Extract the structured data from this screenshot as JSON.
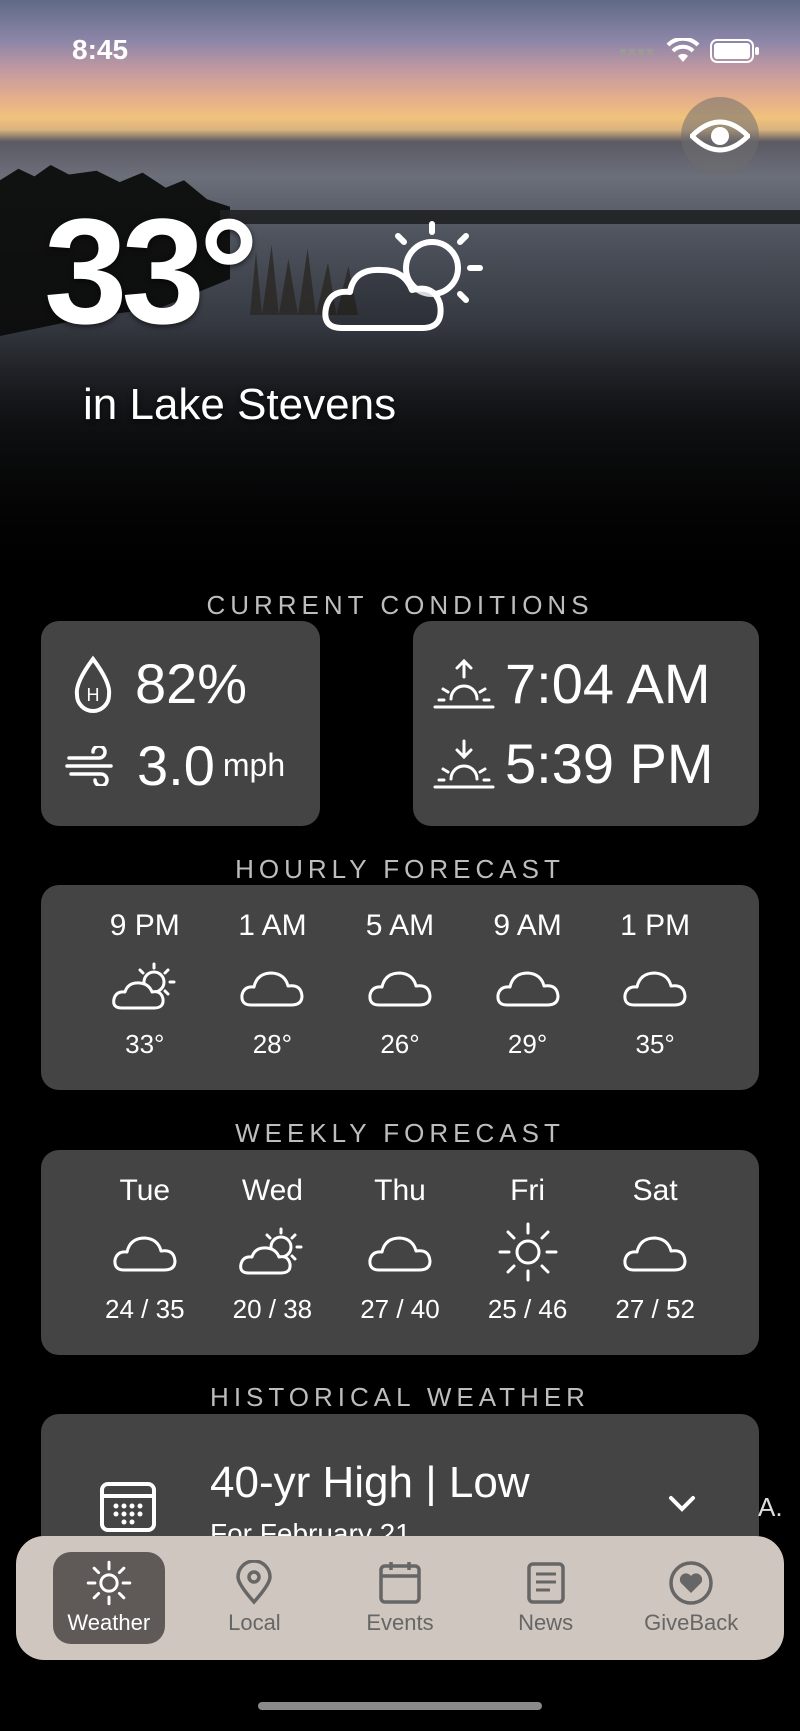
{
  "status_bar": {
    "time": "8:45"
  },
  "hero": {
    "temperature": "33°",
    "location": "in Lake Stevens"
  },
  "sections": {
    "current": "CURRENT CONDITIONS",
    "hourly": "HOURLY FORECAST",
    "weekly": "WEEKLY FORECAST",
    "historical": "HISTORICAL WEATHER"
  },
  "current_conditions": {
    "humidity": "82%",
    "wind": "3.0",
    "wind_unit": "mph",
    "sunrise": "7:04 AM",
    "sunset": "5:39 PM"
  },
  "hourly": [
    {
      "time": "9 PM",
      "icon": "partly-cloudy-icon",
      "temp": "33°"
    },
    {
      "time": "1 AM",
      "icon": "cloud-icon",
      "temp": "28°"
    },
    {
      "time": "5 AM",
      "icon": "cloud-icon",
      "temp": "26°"
    },
    {
      "time": "9 AM",
      "icon": "cloud-icon",
      "temp": "29°"
    },
    {
      "time": "1 PM",
      "icon": "cloud-icon",
      "temp": "35°"
    }
  ],
  "weekly": [
    {
      "day": "Tue",
      "icon": "cloud-icon",
      "range": "24 / 35"
    },
    {
      "day": "Wed",
      "icon": "partly-cloudy-icon",
      "range": "20 / 38"
    },
    {
      "day": "Thu",
      "icon": "cloud-icon",
      "range": "27 / 40"
    },
    {
      "day": "Fri",
      "icon": "sun-icon",
      "range": "25 / 46"
    },
    {
      "day": "Sat",
      "icon": "cloud-icon",
      "range": "27 / 52"
    }
  ],
  "historical": {
    "title": "40-yr High | Low",
    "subtitle": "For February 21",
    "edge_text": "A."
  },
  "nav": [
    {
      "label": "Weather",
      "icon": "sun-icon",
      "active": true
    },
    {
      "label": "Local",
      "icon": "location-pin-icon",
      "active": false
    },
    {
      "label": "Events",
      "icon": "calendar-icon",
      "active": false
    },
    {
      "label": "News",
      "icon": "news-icon",
      "active": false
    },
    {
      "label": "GiveBack",
      "icon": "heart-icon",
      "active": false
    }
  ]
}
